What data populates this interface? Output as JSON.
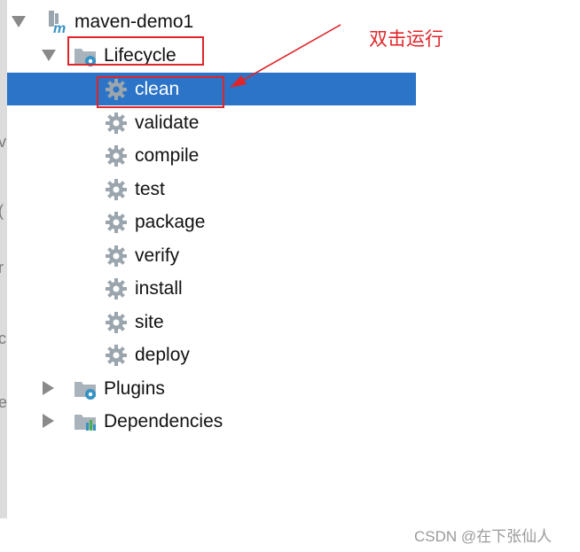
{
  "tree": {
    "root": {
      "label": "maven-demo1",
      "icon": "maven-module-icon",
      "expanded": true
    },
    "lifecycle": {
      "label": "Lifecycle",
      "icon": "lifecycle-folder-icon",
      "expanded": true,
      "phases": [
        {
          "label": "clean",
          "selected": true
        },
        {
          "label": "validate"
        },
        {
          "label": "compile"
        },
        {
          "label": "test"
        },
        {
          "label": "package"
        },
        {
          "label": "verify"
        },
        {
          "label": "install"
        },
        {
          "label": "site"
        },
        {
          "label": "deploy"
        }
      ]
    },
    "plugins": {
      "label": "Plugins",
      "icon": "plugins-folder-icon",
      "expanded": false
    },
    "dependencies": {
      "label": "Dependencies",
      "icon": "dependencies-folder-icon",
      "expanded": false
    }
  },
  "annotation": {
    "text": "双击运行",
    "color": "#e0252a"
  },
  "gutter": {
    "fragments": [
      "v",
      "(",
      "r",
      "c",
      "e"
    ]
  },
  "watermark": "CSDN @在下张仙人",
  "colors": {
    "selection": "#2b74c7",
    "gear": "#9aa5ad",
    "accent_blue": "#3592c4"
  }
}
